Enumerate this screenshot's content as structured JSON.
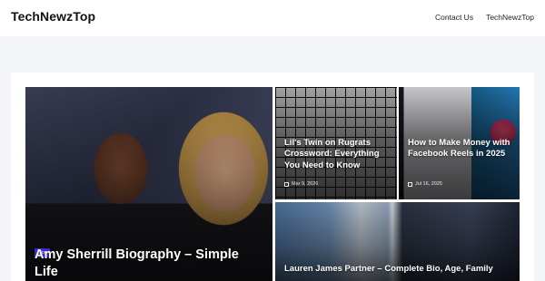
{
  "header": {
    "site_title": "TechNewzTop",
    "nav": [
      {
        "label": "Contact Us"
      },
      {
        "label": "TechNewzTop"
      }
    ]
  },
  "posts": [
    {
      "title": "Amy Sherrill Biography – Simple Life",
      "category": "Blog"
    },
    {
      "title": "Lil's Twin on Rugrats Crossword: Everything You Need to Know",
      "date": "Mar 9, 2026"
    },
    {
      "title": "How to Make Money with Facebook Reels in 2025",
      "date": "Jul 16, 2025"
    },
    {
      "title": "Lauren James Partner – Complete Bio, Age, Family"
    }
  ],
  "colors": {
    "badge": "#3b2bd6",
    "page_background": "#f3f5f8",
    "header_background": "#ffffff"
  },
  "icons": {
    "date": "calendar-icon"
  }
}
